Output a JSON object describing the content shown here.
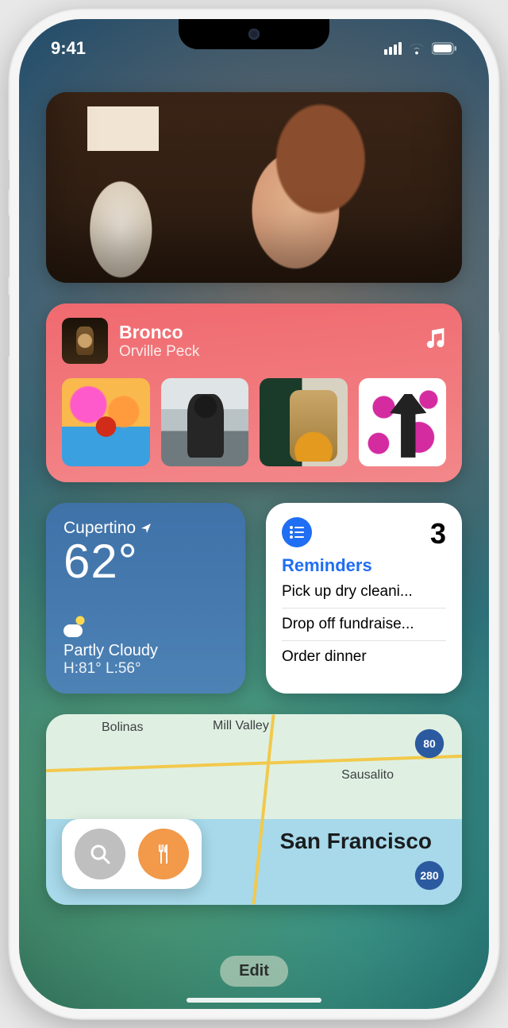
{
  "status": {
    "time": "9:41"
  },
  "music": {
    "title": "Bronco",
    "artist": "Orville Peck"
  },
  "weather": {
    "location": "Cupertino",
    "temperature": "62°",
    "condition": "Partly Cloudy",
    "hilo": "H:81° L:56°"
  },
  "reminders": {
    "count": "3",
    "title": "Reminders",
    "items": [
      "Pick up dry cleani...",
      "Drop off fundraise...",
      "Order dinner"
    ]
  },
  "maps": {
    "labels": [
      "Bolinas",
      "Mill Valley",
      "Sausalito"
    ],
    "city": "San Francisco",
    "shields": [
      "80",
      "280"
    ]
  },
  "edit_label": "Edit"
}
